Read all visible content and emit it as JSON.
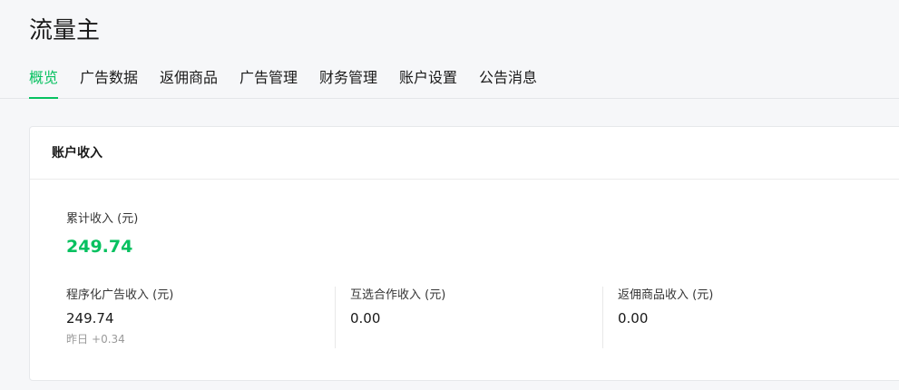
{
  "app": {
    "title": "流量主"
  },
  "tabs": [
    {
      "label": "概览",
      "active": true
    },
    {
      "label": "广告数据",
      "active": false
    },
    {
      "label": "返佣商品",
      "active": false
    },
    {
      "label": "广告管理",
      "active": false
    },
    {
      "label": "财务管理",
      "active": false
    },
    {
      "label": "账户设置",
      "active": false
    },
    {
      "label": "公告消息",
      "active": false
    }
  ],
  "account_income": {
    "title": "账户收入",
    "total": {
      "label": "累计收入 (元)",
      "value": "249.74"
    },
    "metrics": [
      {
        "label": "程序化广告收入 (元)",
        "value": "249.74",
        "sub_label": "昨日",
        "sub_value": "+0.34"
      },
      {
        "label": "互选合作收入 (元)",
        "value": "0.00"
      },
      {
        "label": "返佣商品收入 (元)",
        "value": "0.00"
      }
    ]
  },
  "colors": {
    "accent": "#07c160",
    "background": "#f6f7f9",
    "card": "#ffffff",
    "muted_text": "#9a9a9a"
  }
}
